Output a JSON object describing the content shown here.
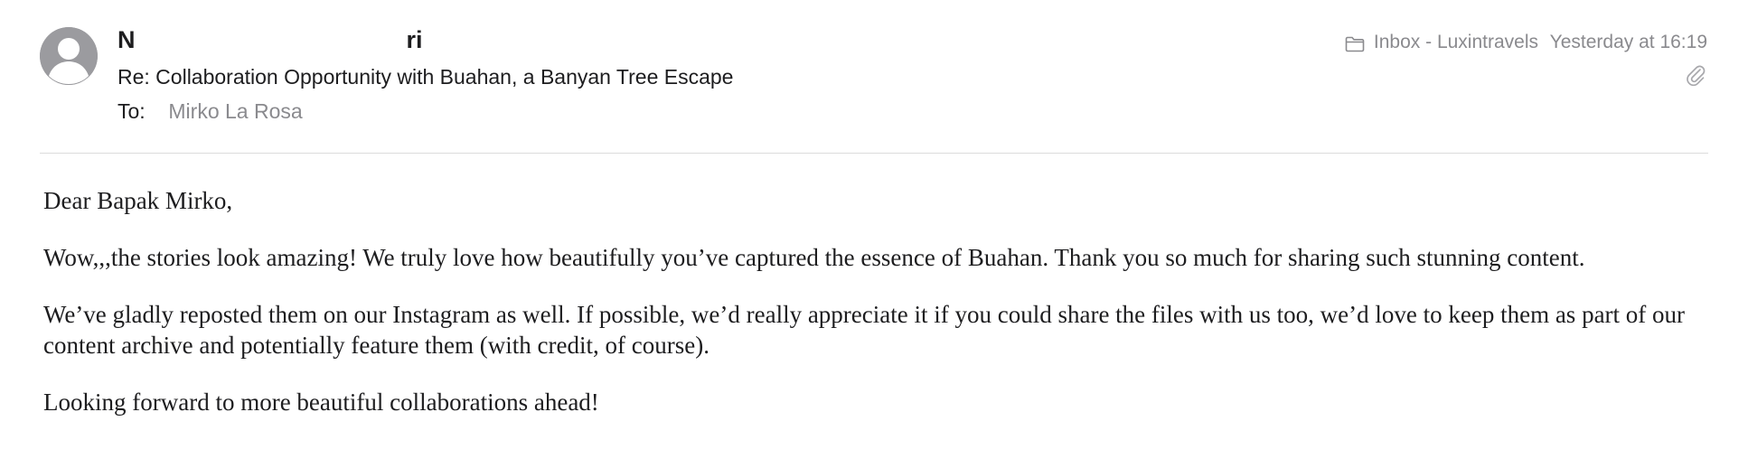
{
  "header": {
    "sender_start": "N",
    "sender_end": "ri",
    "subject": "Re: Collaboration Opportunity with Buahan, a Banyan Tree Escape",
    "to_label": "To:",
    "to_value": "Mirko La Rosa",
    "mailbox": "Inbox - Luxintravels",
    "timestamp": "Yesterday at 16:19",
    "icons": {
      "avatar": "person-avatar-icon",
      "mailbox": "folder-icon",
      "attachment": "paperclip-icon"
    }
  },
  "body": {
    "paragraphs": [
      "Dear Bapak Mirko,",
      "Wow,,,the stories look amazing! We truly love how beautifully you’ve captured the essence of Buahan. Thank you so much for sharing such stunning content.",
      "We’ve gladly reposted them on our Instagram as well. If possible, we’d really appreciate it if you could share the files with us too, we’d love to keep them as part of our content archive and potentially feature them (with credit, of course).",
      "Looking forward to more beautiful collaborations ahead!"
    ]
  },
  "colors": {
    "text": "#1d1d1f",
    "secondary_text": "#8a8a8e",
    "avatar_bg": "#9b9b9f",
    "divider": "#dcdcdc"
  }
}
